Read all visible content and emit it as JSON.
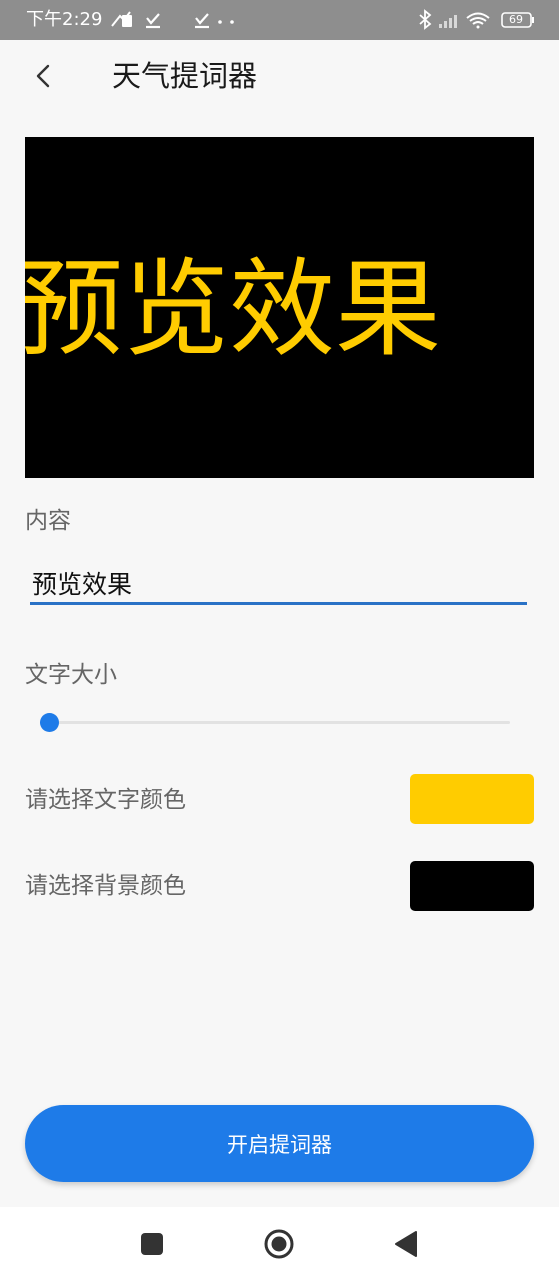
{
  "status_bar": {
    "time": "下午2:29",
    "battery": "69",
    "left_icons": [
      "usb-icon",
      "check-icon",
      "check-icon",
      "more-dots-icon"
    ],
    "right_icons": [
      "bluetooth-icon",
      "signal-icon",
      "wifi-icon",
      "battery-icon"
    ]
  },
  "header": {
    "title": "天气提词器",
    "back_icon": "chevron-left-icon"
  },
  "preview": {
    "text": "预览效果",
    "text_color": "#ffcc00",
    "background_color": "#000000"
  },
  "content": {
    "label": "内容",
    "value": "预览效果"
  },
  "font_size": {
    "label": "文字大小",
    "value": 0.02
  },
  "text_color_picker": {
    "label": "请选择文字颜色",
    "color": "#ffcc00"
  },
  "background_color_picker": {
    "label": "请选择背景颜色",
    "color": "#000000"
  },
  "start_button": {
    "label": "开启提词器"
  },
  "nav_bar": {
    "icons": [
      "recents-square-icon",
      "home-circle-icon",
      "back-triangle-icon"
    ]
  },
  "colors": {
    "accent": "#1e7be8",
    "underline": "#2a72c6"
  }
}
